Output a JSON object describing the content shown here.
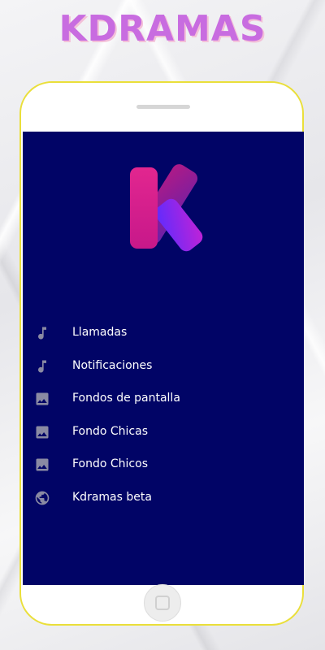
{
  "app_title": "KDRAMAS",
  "colors": {
    "title": "#c86ce0",
    "screen_background": "#010466",
    "phone_border": "#eadf3a",
    "icon": "#8a8aa3"
  },
  "menu": {
    "items": [
      {
        "label": "Llamadas",
        "icon": "music-note-icon"
      },
      {
        "label": "Notificaciones",
        "icon": "music-note-icon"
      },
      {
        "label": "Fondos de pantalla",
        "icon": "image-icon"
      },
      {
        "label": "Fondo Chicas",
        "icon": "image-icon"
      },
      {
        "label": "Fondo Chicos",
        "icon": "image-icon"
      },
      {
        "label": "Kdramas beta",
        "icon": "globe-icon"
      }
    ]
  }
}
